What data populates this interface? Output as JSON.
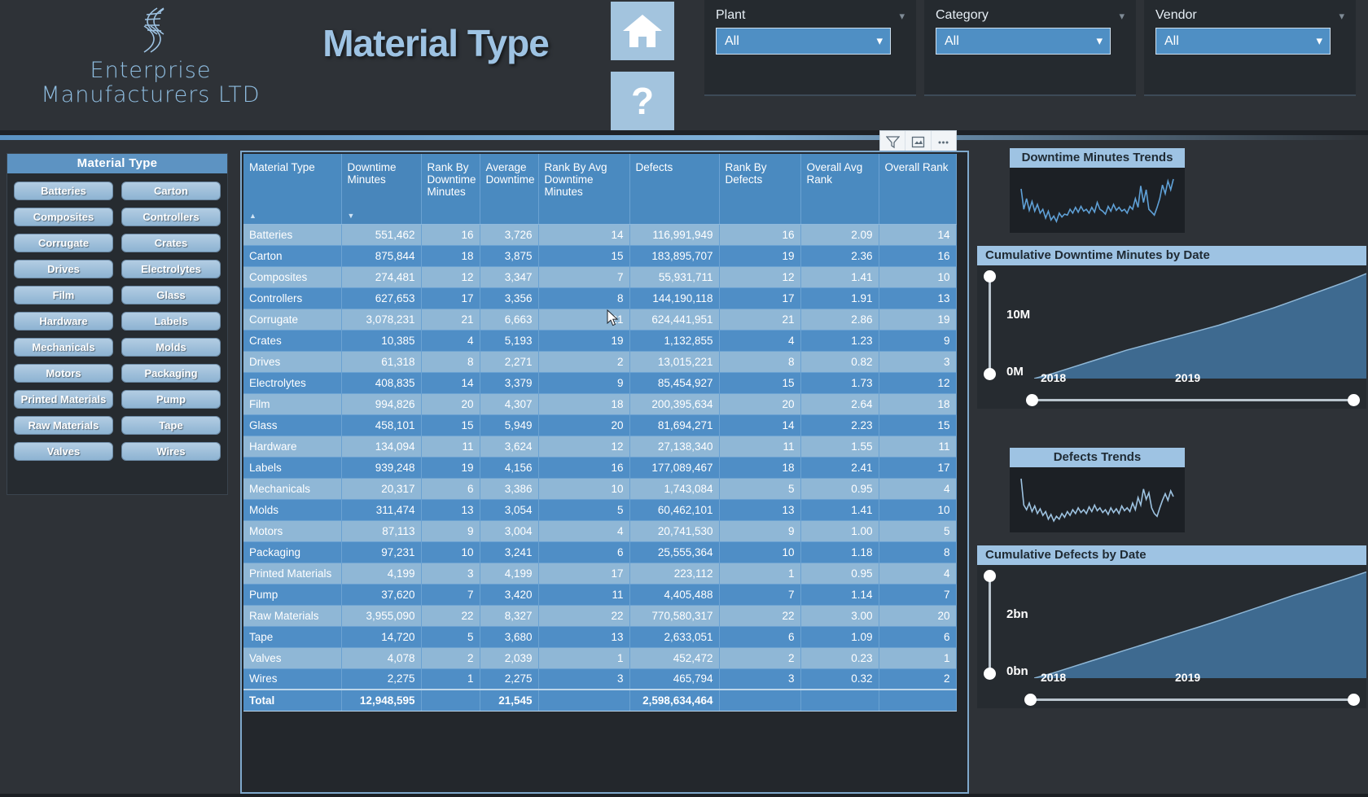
{
  "brand": {
    "line1": "Enterprise",
    "line2": "Manufacturers LTD",
    "logo_icon": "dna-helix-icon"
  },
  "header": {
    "title": "Material Type",
    "home_icon": "home-icon",
    "help_icon": "question-mark-icon"
  },
  "filters": [
    {
      "label": "Plant",
      "value": "All",
      "caret_icon": "chevron-down-icon"
    },
    {
      "label": "Category",
      "value": "All",
      "caret_icon": "chevron-down-icon"
    },
    {
      "label": "Vendor",
      "value": "All",
      "caret_icon": "chevron-down-icon"
    }
  ],
  "slicer": {
    "title": "Material Type",
    "items": [
      "Batteries",
      "Carton",
      "Composites",
      "Controllers",
      "Corrugate",
      "Crates",
      "Drives",
      "Electrolytes",
      "Film",
      "Glass",
      "Hardware",
      "Labels",
      "Mechanicals",
      "Molds",
      "Motors",
      "Packaging",
      "Printed Materials",
      "Pump",
      "Raw Materials",
      "Tape",
      "Valves",
      "Wires"
    ]
  },
  "table_toolbar": {
    "filter_icon": "funnel-icon",
    "focus_icon": "focus-mode-icon",
    "more_icon": "more-options-icon"
  },
  "table": {
    "sort_column": "Downtime Minutes",
    "sort_direction": "desc",
    "columns": [
      "Material Type",
      "Downtime Minutes",
      "Rank By Downtime Minutes",
      "Average Downtime",
      "Rank By Avg Downtime Minutes",
      "Defects",
      "Rank By Defects",
      "Overall Avg Rank",
      "Overall Rank"
    ],
    "rows": [
      [
        "Batteries",
        "551,462",
        "16",
        "3,726",
        "14",
        "116,991,949",
        "16",
        "2.09",
        "14"
      ],
      [
        "Carton",
        "875,844",
        "18",
        "3,875",
        "15",
        "183,895,707",
        "19",
        "2.36",
        "16"
      ],
      [
        "Composites",
        "274,481",
        "12",
        "3,347",
        "7",
        "55,931,711",
        "12",
        "1.41",
        "10"
      ],
      [
        "Controllers",
        "627,653",
        "17",
        "3,356",
        "8",
        "144,190,118",
        "17",
        "1.91",
        "13"
      ],
      [
        "Corrugate",
        "3,078,231",
        "21",
        "6,663",
        "21",
        "624,441,951",
        "21",
        "2.86",
        "19"
      ],
      [
        "Crates",
        "10,385",
        "4",
        "5,193",
        "19",
        "1,132,855",
        "4",
        "1.23",
        "9"
      ],
      [
        "Drives",
        "61,318",
        "8",
        "2,271",
        "2",
        "13,015,221",
        "8",
        "0.82",
        "3"
      ],
      [
        "Electrolytes",
        "408,835",
        "14",
        "3,379",
        "9",
        "85,454,927",
        "15",
        "1.73",
        "12"
      ],
      [
        "Film",
        "994,826",
        "20",
        "4,307",
        "18",
        "200,395,634",
        "20",
        "2.64",
        "18"
      ],
      [
        "Glass",
        "458,101",
        "15",
        "5,949",
        "20",
        "81,694,271",
        "14",
        "2.23",
        "15"
      ],
      [
        "Hardware",
        "134,094",
        "11",
        "3,624",
        "12",
        "27,138,340",
        "11",
        "1.55",
        "11"
      ],
      [
        "Labels",
        "939,248",
        "19",
        "4,156",
        "16",
        "177,089,467",
        "18",
        "2.41",
        "17"
      ],
      [
        "Mechanicals",
        "20,317",
        "6",
        "3,386",
        "10",
        "1,743,084",
        "5",
        "0.95",
        "4"
      ],
      [
        "Molds",
        "311,474",
        "13",
        "3,054",
        "5",
        "60,462,101",
        "13",
        "1.41",
        "10"
      ],
      [
        "Motors",
        "87,113",
        "9",
        "3,004",
        "4",
        "20,741,530",
        "9",
        "1.00",
        "5"
      ],
      [
        "Packaging",
        "97,231",
        "10",
        "3,241",
        "6",
        "25,555,364",
        "10",
        "1.18",
        "8"
      ],
      [
        "Printed Materials",
        "4,199",
        "3",
        "4,199",
        "17",
        "223,112",
        "1",
        "0.95",
        "4"
      ],
      [
        "Pump",
        "37,620",
        "7",
        "3,420",
        "11",
        "4,405,488",
        "7",
        "1.14",
        "7"
      ],
      [
        "Raw Materials",
        "3,955,090",
        "22",
        "8,327",
        "22",
        "770,580,317",
        "22",
        "3.00",
        "20"
      ],
      [
        "Tape",
        "14,720",
        "5",
        "3,680",
        "13",
        "2,633,051",
        "6",
        "1.09",
        "6"
      ],
      [
        "Valves",
        "4,078",
        "2",
        "2,039",
        "1",
        "452,472",
        "2",
        "0.23",
        "1"
      ],
      [
        "Wires",
        "2,275",
        "1",
        "2,275",
        "3",
        "465,794",
        "3",
        "0.32",
        "2"
      ]
    ],
    "total_row": [
      "Total",
      "12,948,595",
      "",
      "21,545",
      "",
      "2,598,634,464",
      "",
      "",
      ""
    ]
  },
  "charts": {
    "downtime_spark": {
      "title": "Downtime Minutes Trends"
    },
    "defects_spark": {
      "title": "Defects Trends"
    },
    "cum_downtime": {
      "title": "Cumulative Downtime Minutes by Date"
    },
    "cum_defects": {
      "title": "Cumulative Defects by Date"
    }
  },
  "chart_data": [
    {
      "type": "line",
      "name": "downtime-minutes-trends-sparkline",
      "title": "Downtime Minutes Trends",
      "xlabel": "",
      "ylabel": "",
      "grid": false,
      "legend": false,
      "values": [
        72,
        30,
        52,
        28,
        46,
        26,
        40,
        22,
        30,
        12,
        26,
        8,
        16,
        5,
        22,
        14,
        20,
        18,
        30,
        22,
        34,
        24,
        36,
        26,
        30,
        22,
        34,
        24,
        44,
        30,
        26,
        20,
        36,
        26,
        40,
        28,
        34,
        26,
        30,
        22,
        36,
        30,
        52,
        34,
        78,
        44,
        70,
        30,
        24,
        18,
        34,
        52,
        80,
        62,
        88,
        70,
        92
      ]
    },
    {
      "type": "line",
      "name": "defects-trends-sparkline",
      "title": "Defects Trends",
      "xlabel": "",
      "ylabel": "",
      "grid": false,
      "legend": false,
      "values": [
        96,
        40,
        30,
        44,
        26,
        38,
        22,
        32,
        18,
        26,
        10,
        20,
        6,
        16,
        10,
        22,
        14,
        26,
        18,
        30,
        22,
        34,
        24,
        30,
        22,
        36,
        26,
        40,
        28,
        34,
        24,
        30,
        20,
        34,
        24,
        32,
        22,
        38,
        28,
        34,
        26,
        44,
        30,
        56,
        40,
        74,
        52,
        66,
        34,
        22,
        16,
        34,
        50,
        64,
        50,
        70,
        58
      ]
    },
    {
      "type": "area",
      "name": "cumulative-downtime-minutes-by-date",
      "title": "Cumulative Downtime Minutes by Date",
      "xlabel": "",
      "ylabel": "",
      "ytick_labels": [
        "0M",
        "10M"
      ],
      "xtick_labels": [
        "2018",
        "2019"
      ],
      "ylim": [
        0,
        13
      ],
      "grid": false,
      "legend": false,
      "x": [
        2018.0,
        2018.1,
        2018.2,
        2018.3,
        2018.4,
        2018.5,
        2018.6,
        2018.7,
        2018.8,
        2018.9,
        2019.0,
        2019.1,
        2019.2,
        2019.3,
        2019.4,
        2019.5,
        2019.6,
        2019.7,
        2019.8
      ],
      "values": [
        0.0,
        0.6,
        1.3,
        2.0,
        2.7,
        3.4,
        4.0,
        4.6,
        5.2,
        5.8,
        6.4,
        7.1,
        7.8,
        8.5,
        9.3,
        10.1,
        10.9,
        11.7,
        12.6
      ]
    },
    {
      "type": "area",
      "name": "cumulative-defects-by-date",
      "title": "Cumulative Defects by Date",
      "xlabel": "",
      "ylabel": "",
      "ytick_labels": [
        "0bn",
        "2bn"
      ],
      "xtick_labels": [
        "2018",
        "2019"
      ],
      "ylim": [
        0,
        2.6
      ],
      "grid": false,
      "legend": false,
      "x": [
        2018.0,
        2018.1,
        2018.2,
        2018.3,
        2018.4,
        2018.5,
        2018.6,
        2018.7,
        2018.8,
        2018.9,
        2019.0,
        2019.1,
        2019.2,
        2019.3,
        2019.4,
        2019.5,
        2019.6,
        2019.7,
        2019.8
      ],
      "values": [
        0.0,
        0.12,
        0.26,
        0.4,
        0.54,
        0.68,
        0.82,
        0.96,
        1.1,
        1.24,
        1.38,
        1.53,
        1.68,
        1.83,
        1.98,
        2.12,
        2.26,
        2.4,
        2.55
      ]
    }
  ],
  "colors": {
    "accent": "#4f8ec6",
    "header_blue": "#4a8ac0",
    "row_light": "#8fb7d6",
    "row_dark": "#4f8ec6",
    "title_blue": "#9ec3e3",
    "page_bg": "#2e3237"
  }
}
